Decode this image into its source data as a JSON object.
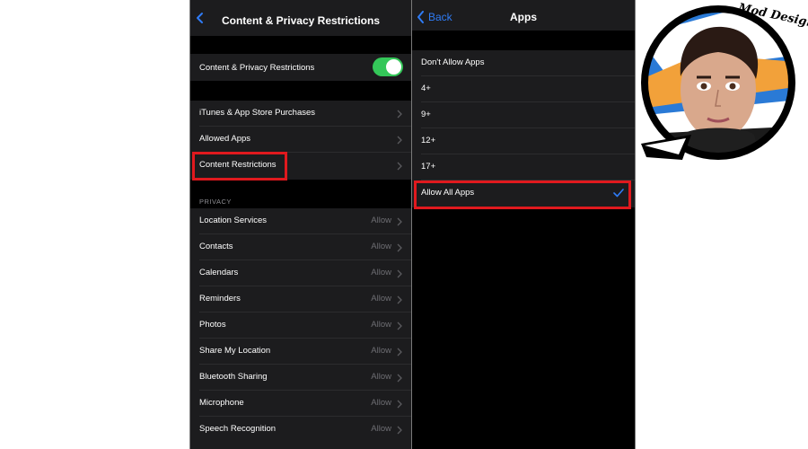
{
  "colors": {
    "accent_blue": "#2f7cf6",
    "toggle_green": "#34c759",
    "highlight_red": "#e0191e",
    "cell_bg": "#1c1c1e",
    "value_gray": "#6e6e73"
  },
  "left_screen": {
    "nav": {
      "back_icon": "chevron-left-icon",
      "title": "Content & Privacy Restrictions"
    },
    "master_toggle": {
      "label": "Content & Privacy Restrictions",
      "on": true
    },
    "menu_items": [
      {
        "label": "iTunes & App Store Purchases"
      },
      {
        "label": "Allowed Apps"
      },
      {
        "label": "Content Restrictions",
        "highlighted": true
      }
    ],
    "privacy_header": "PRIVACY",
    "privacy_items": [
      {
        "label": "Location Services",
        "value": "Allow"
      },
      {
        "label": "Contacts",
        "value": "Allow"
      },
      {
        "label": "Calendars",
        "value": "Allow"
      },
      {
        "label": "Reminders",
        "value": "Allow"
      },
      {
        "label": "Photos",
        "value": "Allow"
      },
      {
        "label": "Share My Location",
        "value": "Allow"
      },
      {
        "label": "Bluetooth Sharing",
        "value": "Allow"
      },
      {
        "label": "Microphone",
        "value": "Allow"
      },
      {
        "label": "Speech Recognition",
        "value": "Allow"
      }
    ]
  },
  "right_screen": {
    "nav": {
      "back_label": "Back",
      "back_icon": "chevron-left-icon",
      "title": "Apps"
    },
    "options": [
      {
        "label": "Don't Allow Apps"
      },
      {
        "label": "4+"
      },
      {
        "label": "9+"
      },
      {
        "label": "12+"
      },
      {
        "label": "17+"
      },
      {
        "label": "Allow All Apps",
        "selected": true,
        "highlighted": true
      }
    ],
    "selected_icon": "checkmark-icon"
  },
  "watermark": {
    "logo_text": "Mod Design",
    "icon": "avatar-badge-logo"
  }
}
